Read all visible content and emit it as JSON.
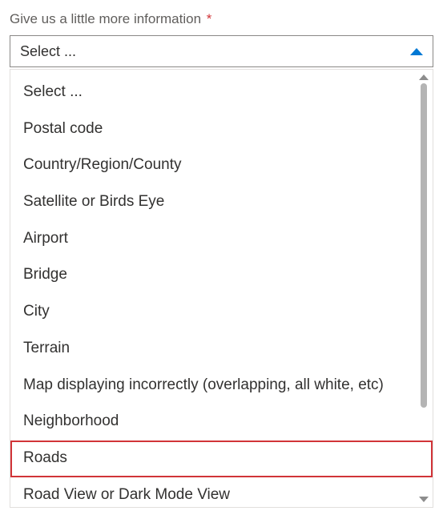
{
  "field": {
    "label": "Give us a little more information",
    "required_marker": "*",
    "selected_text": "Select ..."
  },
  "options": [
    {
      "label": "Select ...",
      "highlighted": false
    },
    {
      "label": "Postal code",
      "highlighted": false
    },
    {
      "label": "Country/Region/County",
      "highlighted": false
    },
    {
      "label": "Satellite or Birds Eye",
      "highlighted": false
    },
    {
      "label": "Airport",
      "highlighted": false
    },
    {
      "label": "Bridge",
      "highlighted": false
    },
    {
      "label": "City",
      "highlighted": false
    },
    {
      "label": "Terrain",
      "highlighted": false
    },
    {
      "label": "Map displaying incorrectly (overlapping, all white, etc)",
      "highlighted": false
    },
    {
      "label": "Neighborhood",
      "highlighted": false
    },
    {
      "label": "Roads",
      "highlighted": true
    },
    {
      "label": "Road View or Dark Mode View",
      "highlighted": false
    }
  ],
  "scroll": {
    "thumb_height_frac": 0.8
  }
}
